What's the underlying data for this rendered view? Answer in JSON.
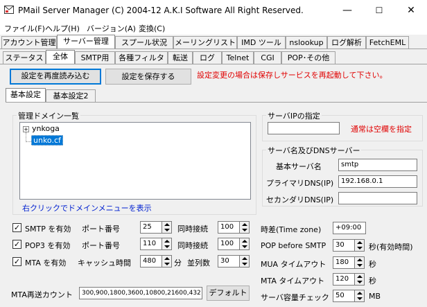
{
  "window": {
    "title": "PMail Server Manager (C) 2004-12 A.K.I Software All Right Reserved.",
    "minimize": "—",
    "maximize": "☐",
    "close": "✕"
  },
  "menu": [
    "ファイル(F)",
    "ヘルプ(H)",
    "バージョン(A)",
    "変換(C)"
  ],
  "main_tabs": [
    "アカウント管理",
    "サーバー管理",
    "スプール状況",
    "メーリングリスト",
    "IMD ツール",
    "nslookup",
    "ログ解析",
    "FetchEML"
  ],
  "sub_tabs": [
    "ステータス",
    "全体",
    "SMTP用",
    "各種フィルタ",
    "転送",
    "ログ",
    "Telnet",
    "CGI",
    "POP･その他"
  ],
  "toolbar": {
    "reload": "設定を再度読み込む",
    "save": "設定を保存する",
    "notice": "設定変更の場合は保存しサービスを再起動して下さい。"
  },
  "settings_tabs": [
    "基本設定",
    "基本設定2"
  ],
  "domain_group": {
    "title": "管理ドメイン一覧",
    "items": [
      "ynkoga",
      "unko.cf"
    ],
    "hint": "右クリックでドメインメニューを表示"
  },
  "server_ip": {
    "title": "サーバIPの指定",
    "value": "",
    "hint": "通常は空欄を指定"
  },
  "dns_group": {
    "title": "サーバ名及びDNSサーバー",
    "host_label": "基本サーバ名",
    "host_value": "smtp",
    "primary_label": "プライマリDNS(IP)",
    "primary_value": "192.168.0.1",
    "secondary_label": "セカンダリDNS(IP)",
    "secondary_value": ""
  },
  "services": [
    {
      "label": "SMTP を有効",
      "check": "✓",
      "port_label": "ポート番号",
      "port": "25",
      "conn_label": "同時接続",
      "conn": "100"
    },
    {
      "label": "POP3 を有効",
      "check": "✓",
      "port_label": "ポート番号",
      "port": "110",
      "conn_label": "同時接続",
      "conn": "100"
    },
    {
      "label": "MTA を有効",
      "check": "✓",
      "port_label": "キャッシュ時間",
      "port": "480",
      "unit": "分",
      "conn_label": "並列数",
      "conn": "30"
    }
  ],
  "right_settings": [
    {
      "label": "時差(Time zone)",
      "value": "+09:00",
      "unit": ""
    },
    {
      "label": "POP before SMTP",
      "value": "30",
      "unit": "秒(有効時間)"
    },
    {
      "label": "MUA タイムアウト",
      "value": "180",
      "unit": "秒"
    },
    {
      "label": "MTA タイムアウト",
      "value": "120",
      "unit": "秒"
    },
    {
      "label": "サーバ容量チェック",
      "value": "50",
      "unit": "MB"
    }
  ],
  "mta_resend": {
    "label": "MTA再送カウント",
    "value": "300,900,1800,3600,10800,21600,432",
    "default_btn": "デフォルト"
  }
}
